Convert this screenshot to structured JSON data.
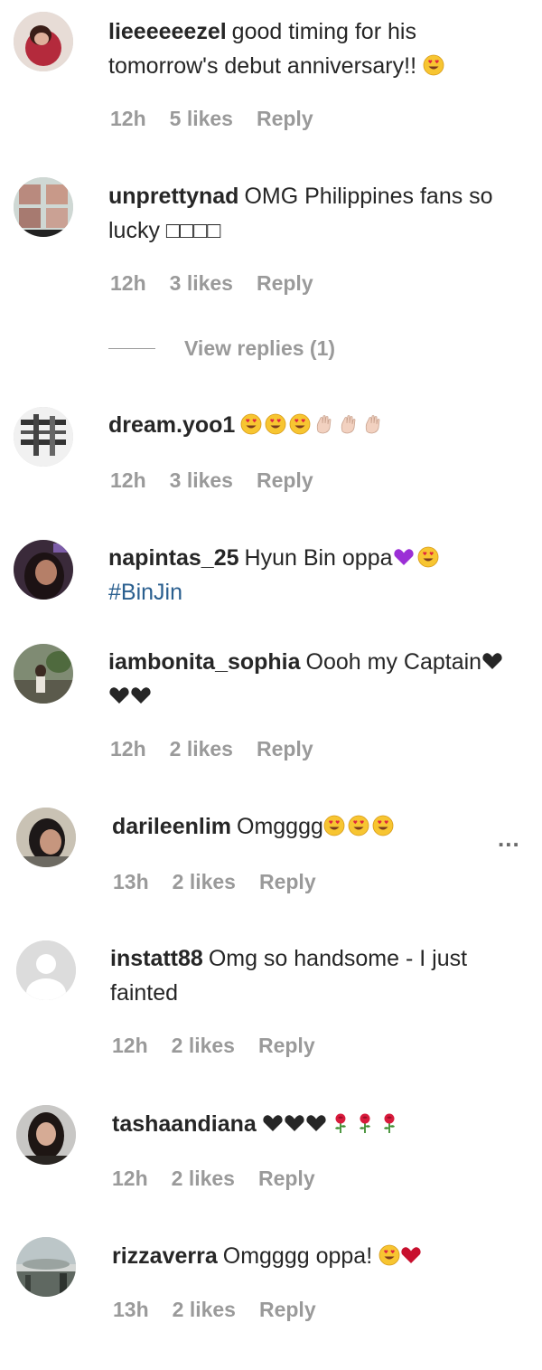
{
  "comments": [
    {
      "username": "lieeeeeezel",
      "text": "good timing for his tomorrow's debut anniversary!!",
      "time": "12h",
      "likes": "5 likes",
      "reply": "Reply"
    },
    {
      "username": "unprettynad",
      "text": "OMG Philippines fans so lucky □□□□",
      "time": "12h",
      "likes": "3 likes",
      "reply": "Reply",
      "view_replies": "View replies (1)"
    },
    {
      "username": "dream.yoo1",
      "text": "",
      "time": "12h",
      "likes": "3 likes",
      "reply": "Reply"
    },
    {
      "username": "napintas_25",
      "text": "Hyun Bin oppa",
      "hashtag": "#BinJin"
    },
    {
      "username": "iambonita_sophia",
      "text": "Oooh my Captain",
      "time": "12h",
      "likes": "2 likes",
      "reply": "Reply"
    },
    {
      "username": "darileenlim",
      "text": "Omgggg",
      "time": "13h",
      "likes": "2 likes",
      "reply": "Reply",
      "more": "..."
    },
    {
      "username": "instatt88",
      "text": "Omg so handsome - I just fainted",
      "time": "12h",
      "likes": "2 likes",
      "reply": "Reply"
    },
    {
      "username": "tashaandiana",
      "text": "",
      "time": "12h",
      "likes": "2 likes",
      "reply": "Reply"
    },
    {
      "username": "rizzaverra",
      "text": "Omgggg oppa!",
      "time": "13h",
      "likes": "2 likes",
      "reply": "Reply"
    }
  ],
  "icons": {
    "smiley": "heart-eyes-emoji",
    "clap": "clapping-hands-emoji",
    "purple_heart": "purple-heart-emoji",
    "black_heart": "black-heart-emoji",
    "rose": "rose-emoji",
    "red_heart": "red-heart-emoji"
  },
  "colors": {
    "text": "#262626",
    "meta": "#9a9a9a",
    "hashtag": "#2a5f8f"
  }
}
